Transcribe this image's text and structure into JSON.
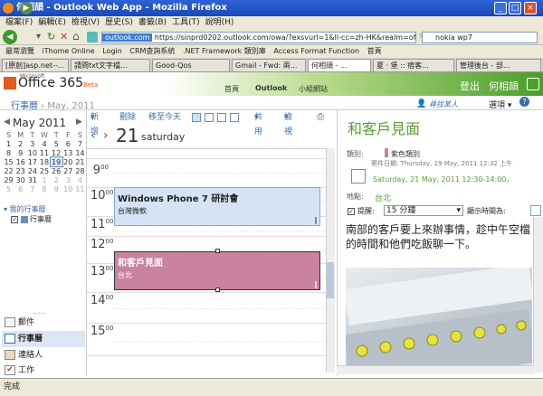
{
  "window": {
    "title": "何相頡 - Outlook Web App - Mozilla Firefox",
    "min": "_",
    "max": "□",
    "close": "×"
  },
  "menu": [
    "檔案(F)",
    "編輯(E)",
    "檢視(V)",
    "歷史(S)",
    "書籤(B)",
    "工具(T)",
    "說明(H)"
  ],
  "address": {
    "domain": "outlook.com",
    "url": "https://sinprd0202.outlook.com/owa/?exsvurl=1&ll-cc=zh-HK&realm=office365.",
    "search": "nokia wp7"
  },
  "bookmarks": [
    "最常瀏覽",
    "iThome Online",
    "Login",
    "CRM查詢系統",
    ".NET Framework 類別庫",
    "Access Format Function",
    "首頁"
  ],
  "tabs": [
    "[原創]asp.net--...",
    "請問txt文字檔...",
    "Good-Qos",
    "Gmail - Fwd: 兩...",
    "何相頡 - ...",
    "夏 ‧ 堡 :: 痞客...",
    "管理後台 - 部..."
  ],
  "o365": {
    "logo_small": "Microsoft",
    "logo": "Office 365",
    "beta": "Beta",
    "links": [
      "首頁",
      "Outlook",
      "小組網站"
    ],
    "signout": "登出",
    "user": "何相頡"
  },
  "section": {
    "title": "行事曆",
    "sub": "May, 2011"
  },
  "find_people": "尋找某人",
  "options": "選項",
  "help": "?",
  "mini_calendar": {
    "title": "May 2011",
    "prev": "◀",
    "next": "▶",
    "weekdays": [
      "S",
      "M",
      "T",
      "W",
      "T",
      "F",
      "S"
    ],
    "weeks": [
      [
        "1",
        "2",
        "3",
        "4",
        "5",
        "6",
        "7"
      ],
      [
        "8",
        "9",
        "10",
        "11",
        "12",
        "13",
        "14"
      ],
      [
        "15",
        "16",
        "17",
        "18",
        "19",
        "20",
        "21"
      ],
      [
        "22",
        "23",
        "24",
        "25",
        "26",
        "27",
        "28"
      ],
      [
        "29",
        "30",
        "31",
        "1",
        "2",
        "3",
        "4"
      ],
      [
        "5",
        "6",
        "7",
        "8",
        "9",
        "10",
        "11"
      ]
    ],
    "today": "19"
  },
  "my_calendars": {
    "header": "我的行事曆",
    "item": "行事曆"
  },
  "dots": ".....",
  "nav": {
    "mail": "郵件",
    "calendar": "行事曆",
    "contacts": "連絡人",
    "tasks": "工作"
  },
  "toolbar": {
    "new": "新增",
    "delete": "刪除",
    "go_today": "移至今天",
    "share": "共用",
    "view": "檢視"
  },
  "day": {
    "prev": "‹",
    "next": "›",
    "number": "21",
    "name": "saturday"
  },
  "hours": [
    "9",
    "10",
    "11",
    "12",
    "13",
    "14",
    "15"
  ],
  "events": [
    {
      "title": "Windows Phone 7 研討會",
      "location": "台灣微軟"
    },
    {
      "title": "和客戶見面",
      "location": "台北"
    }
  ],
  "detail": {
    "title": "和客戶見面",
    "category_label": "類別:",
    "category_value": "紫色類別",
    "sent": "寄件日期: Thursday, 19 May, 2011 12:32 上午",
    "when": "Saturday, 21 May, 2011 12:30-14:00。",
    "location_label": "地點:",
    "location_value": "台北",
    "reminder_label": "提醒:",
    "reminder_value": "15 分鐘",
    "showas_label": "顯示時間為:",
    "body": "南部的客戶要上來辦事情，趁中午空檔的時間和他們吃飯聊一下。"
  },
  "status": "完成",
  "colors": {
    "o365_orange": "#e35a1a",
    "accent_green": "#5a9e34",
    "event_blue": "#d6e3f4",
    "event_purple": "#c9829f"
  }
}
